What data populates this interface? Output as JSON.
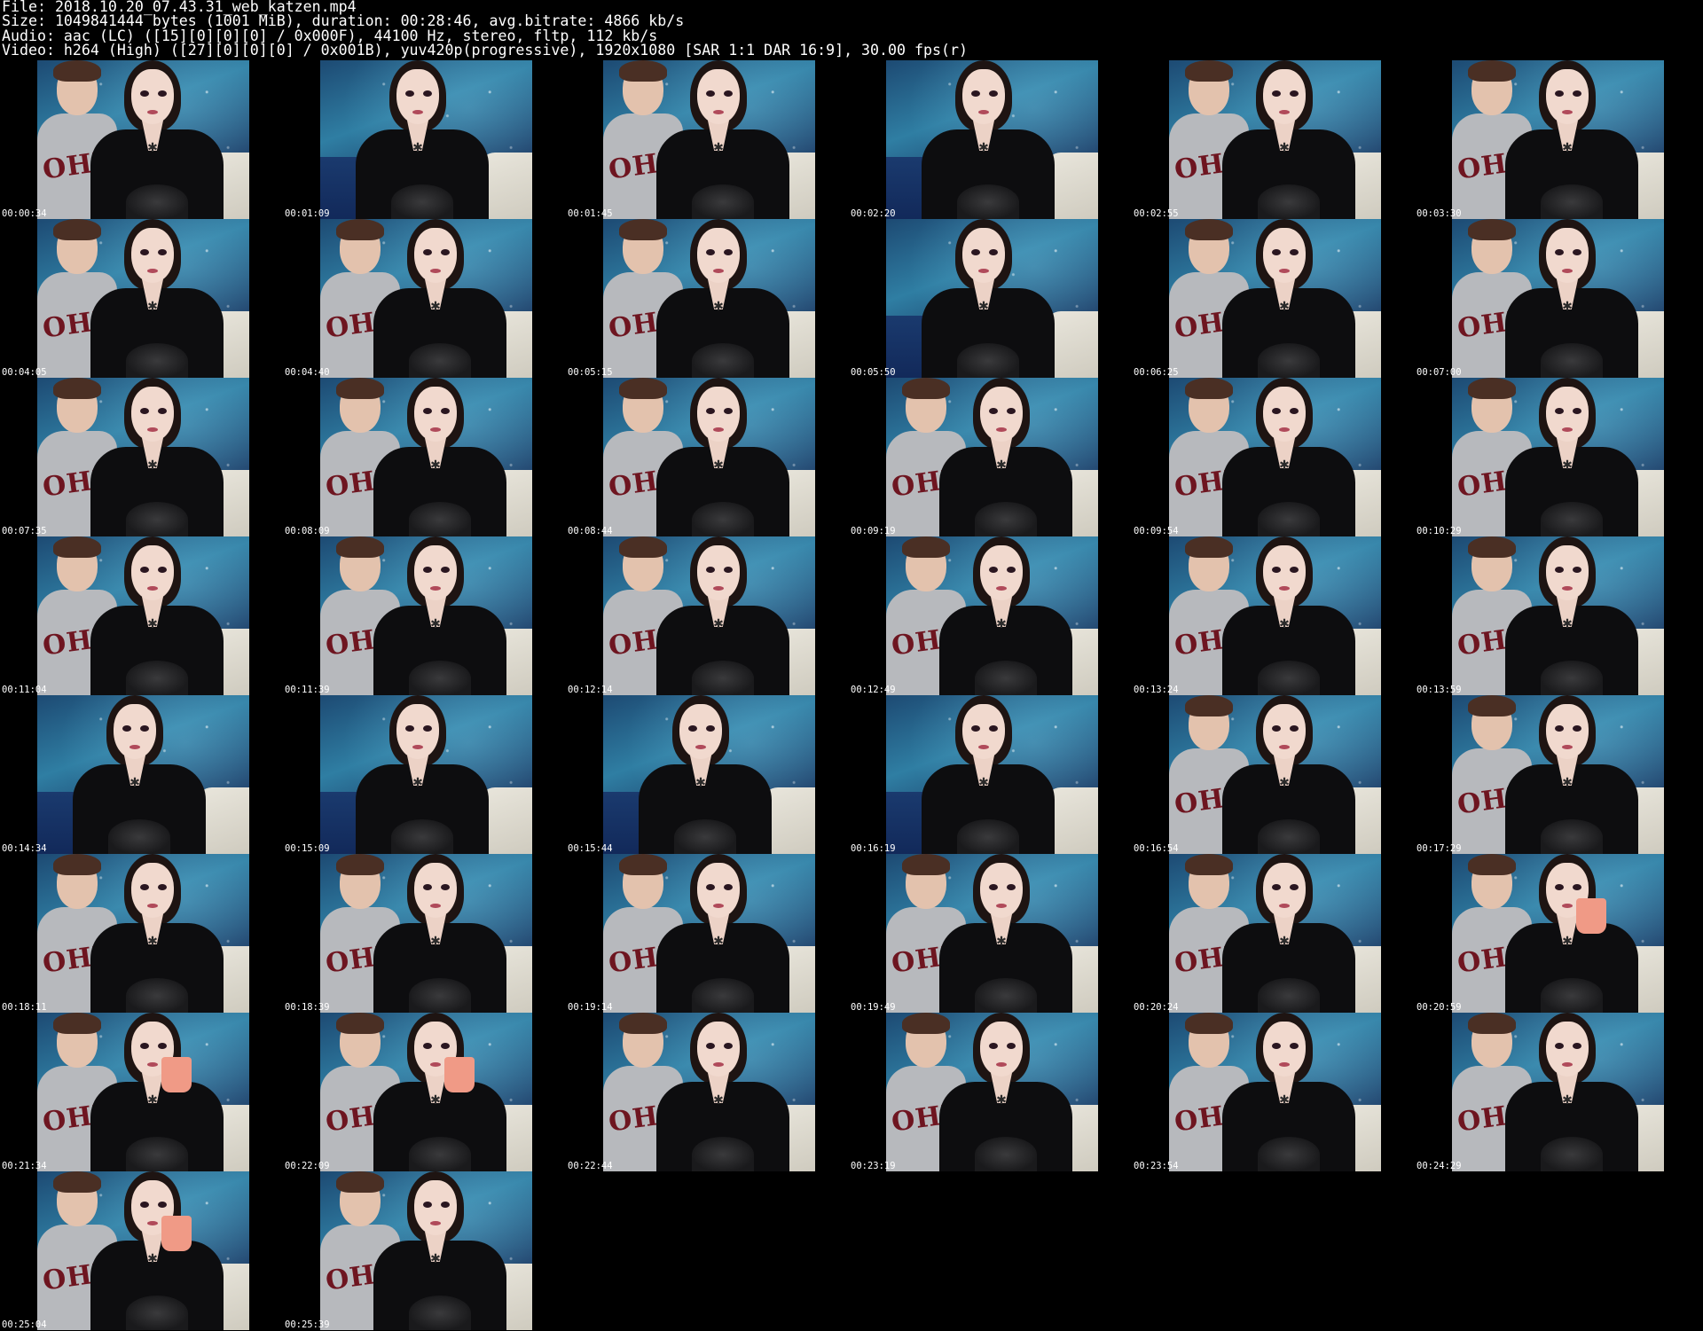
{
  "header": {
    "file_line": "File: 2018.10.20_07.43.31_web_katzen.mp4",
    "size_line": "Size: 1049841444 bytes (1001 MiB), duration: 00:28:46, avg.bitrate: 4866 kb/s",
    "audio_line": "Audio: aac (LC) ([15][0][0][0] / 0x000F), 44100 Hz, stereo, fltp, 112 kb/s",
    "video_line": "Video: h264 (High) ([27][0][0][0] / 0x001B), yuv420p(progressive), 1920x1080 [SAR 1:1 DAR 16:9], 30.00 fps(r)"
  },
  "shirt_text": "OHIO",
  "tattoo_glyph": "✱",
  "colors": {
    "background": "#000000",
    "text": "#ffffff",
    "wall_sky": "#2f7ea3",
    "couch": "#12295a",
    "guy_shirt": "#b7b9bd",
    "girl_shirt": "#0d0d0f",
    "mug": "#f09a86"
  },
  "thumbnails": [
    {
      "time": "00:00:34",
      "guy": true,
      "mug": false
    },
    {
      "time": "00:01:09",
      "guy": false,
      "mug": false
    },
    {
      "time": "00:01:45",
      "guy": true,
      "mug": false
    },
    {
      "time": "00:02:20",
      "guy": false,
      "mug": false
    },
    {
      "time": "00:02:55",
      "guy": true,
      "mug": false
    },
    {
      "time": "00:03:30",
      "guy": true,
      "mug": false
    },
    {
      "time": "00:04:05",
      "guy": true,
      "mug": false
    },
    {
      "time": "00:04:40",
      "guy": true,
      "mug": false
    },
    {
      "time": "00:05:15",
      "guy": true,
      "mug": false
    },
    {
      "time": "00:05:50",
      "guy": false,
      "mug": false
    },
    {
      "time": "00:06:25",
      "guy": true,
      "mug": false
    },
    {
      "time": "00:07:00",
      "guy": true,
      "mug": false
    },
    {
      "time": "00:07:35",
      "guy": true,
      "mug": false
    },
    {
      "time": "00:08:09",
      "guy": true,
      "mug": false
    },
    {
      "time": "00:08:44",
      "guy": true,
      "mug": false
    },
    {
      "time": "00:09:19",
      "guy": true,
      "mug": false
    },
    {
      "time": "00:09:54",
      "guy": true,
      "mug": false
    },
    {
      "time": "00:10:29",
      "guy": true,
      "mug": false
    },
    {
      "time": "00:11:04",
      "guy": true,
      "mug": false
    },
    {
      "time": "00:11:39",
      "guy": true,
      "mug": false
    },
    {
      "time": "00:12:14",
      "guy": true,
      "mug": false
    },
    {
      "time": "00:12:49",
      "guy": true,
      "mug": false
    },
    {
      "time": "00:13:24",
      "guy": true,
      "mug": false
    },
    {
      "time": "00:13:59",
      "guy": true,
      "mug": false
    },
    {
      "time": "00:14:34",
      "guy": false,
      "mug": false
    },
    {
      "time": "00:15:09",
      "guy": false,
      "mug": false
    },
    {
      "time": "00:15:44",
      "guy": false,
      "mug": false
    },
    {
      "time": "00:16:19",
      "guy": false,
      "mug": false
    },
    {
      "time": "00:16:54",
      "guy": true,
      "mug": false
    },
    {
      "time": "00:17:29",
      "guy": true,
      "mug": false
    },
    {
      "time": "00:18:11",
      "guy": true,
      "mug": false
    },
    {
      "time": "00:18:39",
      "guy": true,
      "mug": false
    },
    {
      "time": "00:19:14",
      "guy": true,
      "mug": false
    },
    {
      "time": "00:19:49",
      "guy": true,
      "mug": false
    },
    {
      "time": "00:20:24",
      "guy": true,
      "mug": false
    },
    {
      "time": "00:20:59",
      "guy": true,
      "mug": true
    },
    {
      "time": "00:21:34",
      "guy": true,
      "mug": true
    },
    {
      "time": "00:22:09",
      "guy": true,
      "mug": true
    },
    {
      "time": "00:22:44",
      "guy": true,
      "mug": false
    },
    {
      "time": "00:23:19",
      "guy": true,
      "mug": false
    },
    {
      "time": "00:23:54",
      "guy": true,
      "mug": false
    },
    {
      "time": "00:24:29",
      "guy": true,
      "mug": false
    },
    {
      "time": "00:25:04",
      "guy": true,
      "mug": true
    },
    {
      "time": "00:25:39",
      "guy": true,
      "mug": false
    }
  ]
}
